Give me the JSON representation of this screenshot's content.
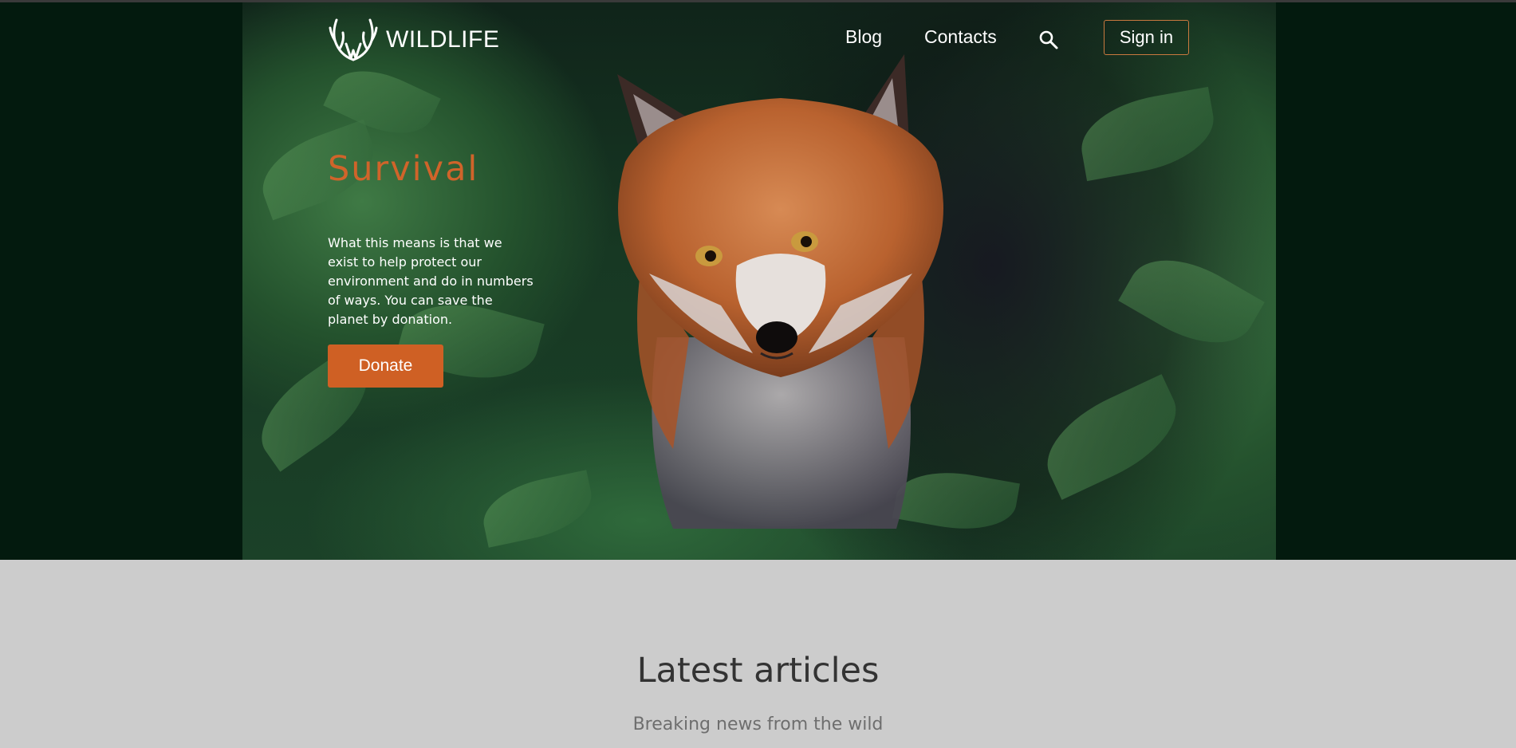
{
  "header": {
    "logo_text": "WILDLIFE",
    "nav": {
      "blog": "Blog",
      "contacts": "Contacts"
    },
    "search_icon": "search-icon",
    "signin_label": "Sign in"
  },
  "hero": {
    "title": "Survival",
    "text": "What this means is that we exist to help protect our environment and do in numbers of ways. You can save the planet by donation.",
    "donate_label": "Donate",
    "image_subject": "red fox in green foliage"
  },
  "articles": {
    "title": "Latest articles",
    "subtitle": "Breaking news from the wild"
  },
  "colors": {
    "accent": "#cf6024",
    "hero_band": "#031a0e",
    "page_bg": "#cccccc"
  }
}
